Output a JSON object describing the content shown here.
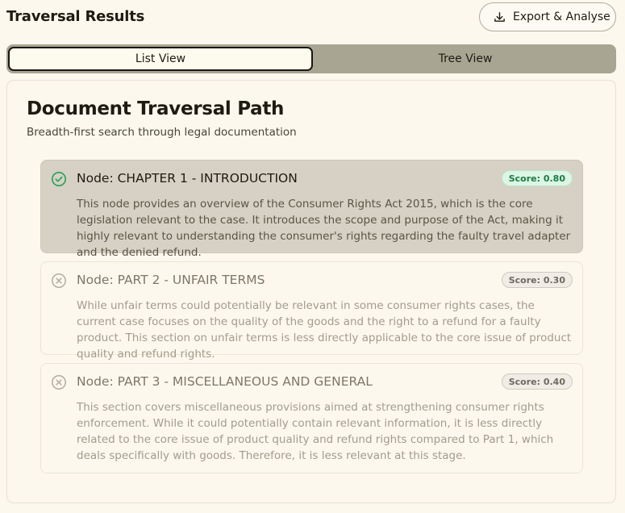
{
  "header": {
    "title": "Traversal Results",
    "export_label": "Export & Analyse"
  },
  "tabs": [
    {
      "label": "List View",
      "active": true
    },
    {
      "label": "Tree View",
      "active": false
    }
  ],
  "card": {
    "title": "Document Traversal Path",
    "subtitle": "Breadth-first search through legal documentation"
  },
  "nodes": [
    {
      "title": "Node: CHAPTER 1 - INTRODUCTION",
      "score": "Score: 0.80",
      "status": "selected",
      "icon": "check-circle-icon",
      "description": "This node provides an overview of the Consumer Rights Act 2015, which is the core legislation relevant to the case. It introduces the scope and purpose of the Act, making it highly relevant to understanding the consumer's rights regarding the faulty travel adapter and the denied refund."
    },
    {
      "title": "Node: PART 2 - UNFAIR TERMS",
      "score": "Score: 0.30",
      "status": "rejected",
      "icon": "x-circle-icon",
      "description": "While unfair terms could potentially be relevant in some consumer rights cases, the current case focuses on the quality of the goods and the right to a refund for a faulty product. This section on unfair terms is less directly applicable to the core issue of product quality and refund rights."
    },
    {
      "title": "Node: PART 3 - MISCELLANEOUS AND GENERAL",
      "score": "Score: 0.40",
      "status": "rejected",
      "icon": "x-circle-icon",
      "description": "This section covers miscellaneous provisions aimed at strengthening consumer rights enforcement. While it could potentially contain relevant information, it is less directly related to the core issue of product quality and refund rights compared to Part 1, which deals specifically with goods. Therefore, it is less relevant at this stage."
    }
  ],
  "colors": {
    "background": "#fcf8ee",
    "selected_node": "#d6d1c4",
    "good_score": "#1f7a45",
    "accent_check": "#22a05a"
  }
}
